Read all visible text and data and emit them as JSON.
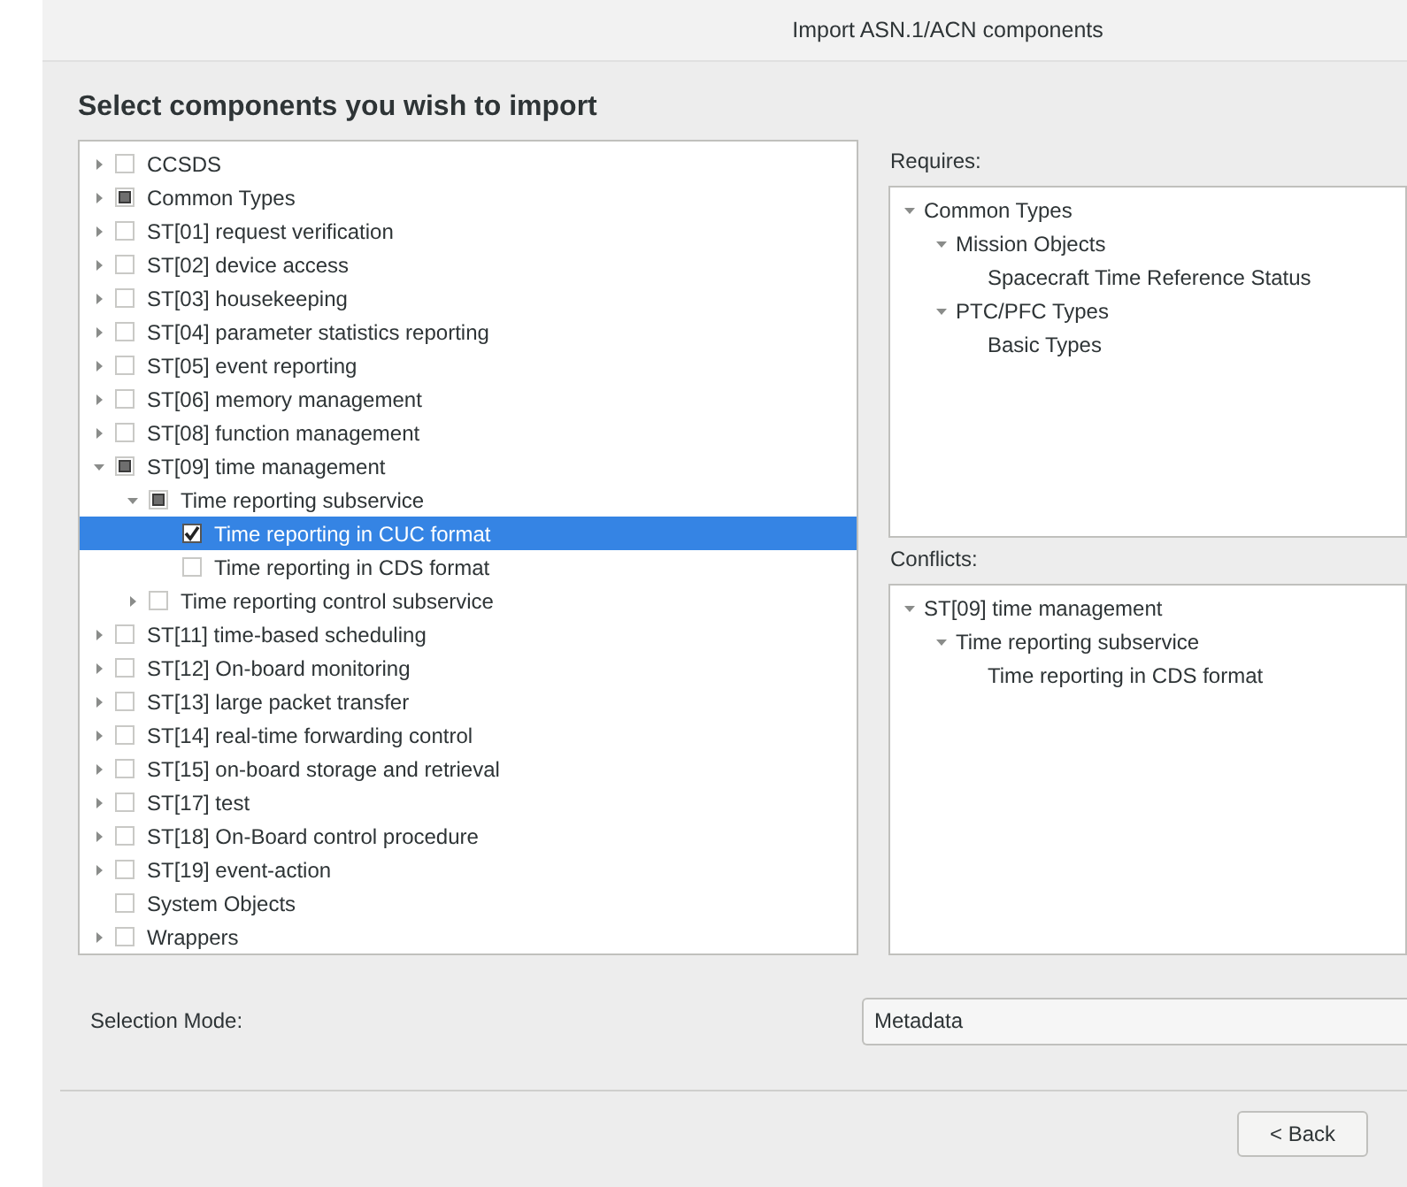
{
  "window": {
    "title": "Import ASN.1/ACN components"
  },
  "heading": "Select components you wish to import",
  "components": [
    {
      "label": "CCSDS",
      "expanded": false,
      "checked": false,
      "partial": false,
      "selected": false
    },
    {
      "label": "Common Types",
      "expanded": false,
      "checked": false,
      "partial": true,
      "selected": false
    },
    {
      "label": "ST[01] request verification",
      "expanded": false,
      "checked": false,
      "partial": false,
      "selected": false
    },
    {
      "label": "ST[02] device access",
      "expanded": false,
      "checked": false,
      "partial": false,
      "selected": false
    },
    {
      "label": "ST[03] housekeeping",
      "expanded": false,
      "checked": false,
      "partial": false,
      "selected": false
    },
    {
      "label": "ST[04] parameter statistics reporting",
      "expanded": false,
      "checked": false,
      "partial": false,
      "selected": false
    },
    {
      "label": "ST[05] event reporting",
      "expanded": false,
      "checked": false,
      "partial": false,
      "selected": false
    },
    {
      "label": "ST[06] memory management",
      "expanded": false,
      "checked": false,
      "partial": false,
      "selected": false
    },
    {
      "label": "ST[08] function management",
      "expanded": false,
      "checked": false,
      "partial": false,
      "selected": false
    },
    {
      "label": "ST[09] time management",
      "expanded": true,
      "checked": false,
      "partial": true,
      "selected": false,
      "children": [
        {
          "label": "Time reporting subservice",
          "expanded": true,
          "checked": false,
          "partial": true,
          "selected": false,
          "children": [
            {
              "label": "Time reporting in CUC format",
              "checked": true,
              "partial": false,
              "selected": true
            },
            {
              "label": "Time reporting in CDS format",
              "checked": false,
              "partial": false,
              "selected": false
            }
          ]
        },
        {
          "label": "Time reporting control subservice",
          "expanded": false,
          "checked": false,
          "partial": false,
          "selected": false
        }
      ]
    },
    {
      "label": "ST[11] time-based scheduling",
      "expanded": false,
      "checked": false,
      "partial": false,
      "selected": false
    },
    {
      "label": "ST[12] On-board monitoring",
      "expanded": false,
      "checked": false,
      "partial": false,
      "selected": false
    },
    {
      "label": "ST[13] large packet transfer",
      "expanded": false,
      "checked": false,
      "partial": false,
      "selected": false
    },
    {
      "label": "ST[14] real-time forwarding control",
      "expanded": false,
      "checked": false,
      "partial": false,
      "selected": false
    },
    {
      "label": "ST[15] on-board storage and retrieval",
      "expanded": false,
      "checked": false,
      "partial": false,
      "selected": false
    },
    {
      "label": "ST[17] test",
      "expanded": false,
      "checked": false,
      "partial": false,
      "selected": false
    },
    {
      "label": "ST[18] On-Board control procedure",
      "expanded": false,
      "checked": false,
      "partial": false,
      "selected": false
    },
    {
      "label": "ST[19] event-action",
      "expanded": false,
      "checked": false,
      "partial": false,
      "selected": false
    },
    {
      "label": "System Objects",
      "checked": false,
      "partial": false,
      "selected": false
    },
    {
      "label": "Wrappers",
      "expanded": false,
      "checked": false,
      "partial": false,
      "selected": false
    }
  ],
  "requires": {
    "label": "Requires:",
    "items": [
      {
        "label": "Common Types",
        "expanded": true,
        "children": [
          {
            "label": "Mission Objects",
            "expanded": true,
            "children": [
              {
                "label": "Spacecraft Time Reference Status"
              }
            ]
          },
          {
            "label": "PTC/PFC Types",
            "expanded": true,
            "children": [
              {
                "label": "Basic Types"
              }
            ]
          }
        ]
      }
    ]
  },
  "conflicts": {
    "label": "Conflicts:",
    "items": [
      {
        "label": "ST[09] time management",
        "expanded": true,
        "children": [
          {
            "label": "Time reporting subservice",
            "expanded": true,
            "children": [
              {
                "label": "Time reporting in CDS format"
              }
            ]
          }
        ]
      }
    ]
  },
  "selection_mode": {
    "label": "Selection Mode:",
    "value": "Metadata"
  },
  "buttons": [
    {
      "label": "< Back"
    }
  ]
}
